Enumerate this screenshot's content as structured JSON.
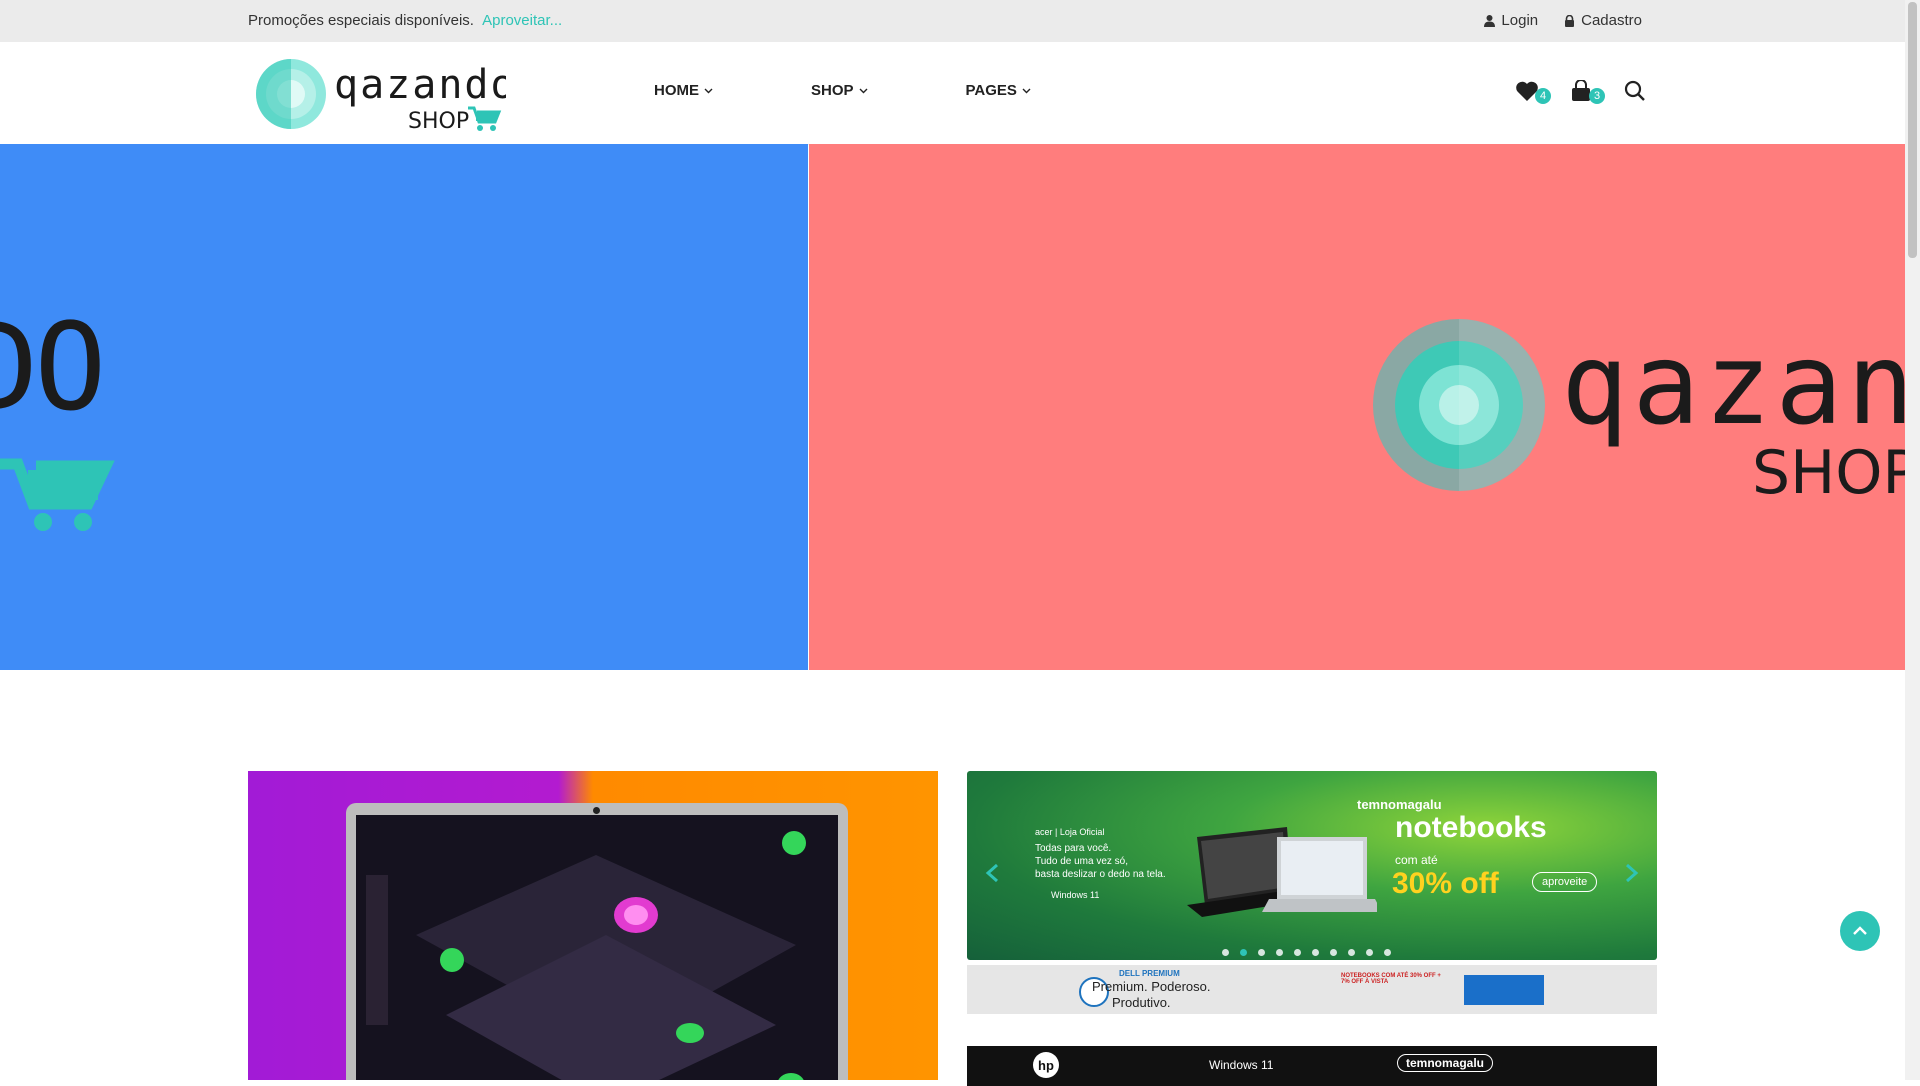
{
  "topbar": {
    "promo_text": "Promoções especiais disponíveis.",
    "promo_link": "Aproveitar...",
    "login": "Login",
    "register": "Cadastro"
  },
  "logo": {
    "brand": "qazando",
    "sub": "SHOP"
  },
  "nav": {
    "items": [
      {
        "label": "HOME"
      },
      {
        "label": "SHOP"
      },
      {
        "label": "PAGES"
      }
    ]
  },
  "header_icons": {
    "wishlist_count": "4",
    "cart_count": "3"
  },
  "hero": {
    "left_text": "DO",
    "right_brand": "qazando",
    "right_sub": "SHOP"
  },
  "carousel": {
    "brand_tag": "temnomagalu",
    "headline": "notebooks",
    "subline": "com até",
    "discount": "30% off",
    "cta": "aproveite",
    "acer": "acer | Loja Oficial",
    "acer_text_1": "Todas para você.",
    "acer_text_2": "Tudo de uma vez só,",
    "acer_text_3": "basta deslizar o dedo na tela.",
    "windows": "Windows 11",
    "dot_count": 10,
    "active_dot": 1
  },
  "ad_small": {
    "brand": "DELL PREMIUM",
    "text_1": "Premium. Poderoso.",
    "text_2": "Produtivo.",
    "promo": "NOTEBOOKS COM ATÉ 30% OFF + 7% OFF À VISTA"
  },
  "ad_hp": {
    "windows": "Windows 11",
    "brand_tag": "temnomagalu"
  },
  "colors": {
    "accent": "#2ec4b6",
    "hero_left": "#3f8cf7",
    "hero_right": "#ff7d7d",
    "topbar": "#ebebeb"
  }
}
